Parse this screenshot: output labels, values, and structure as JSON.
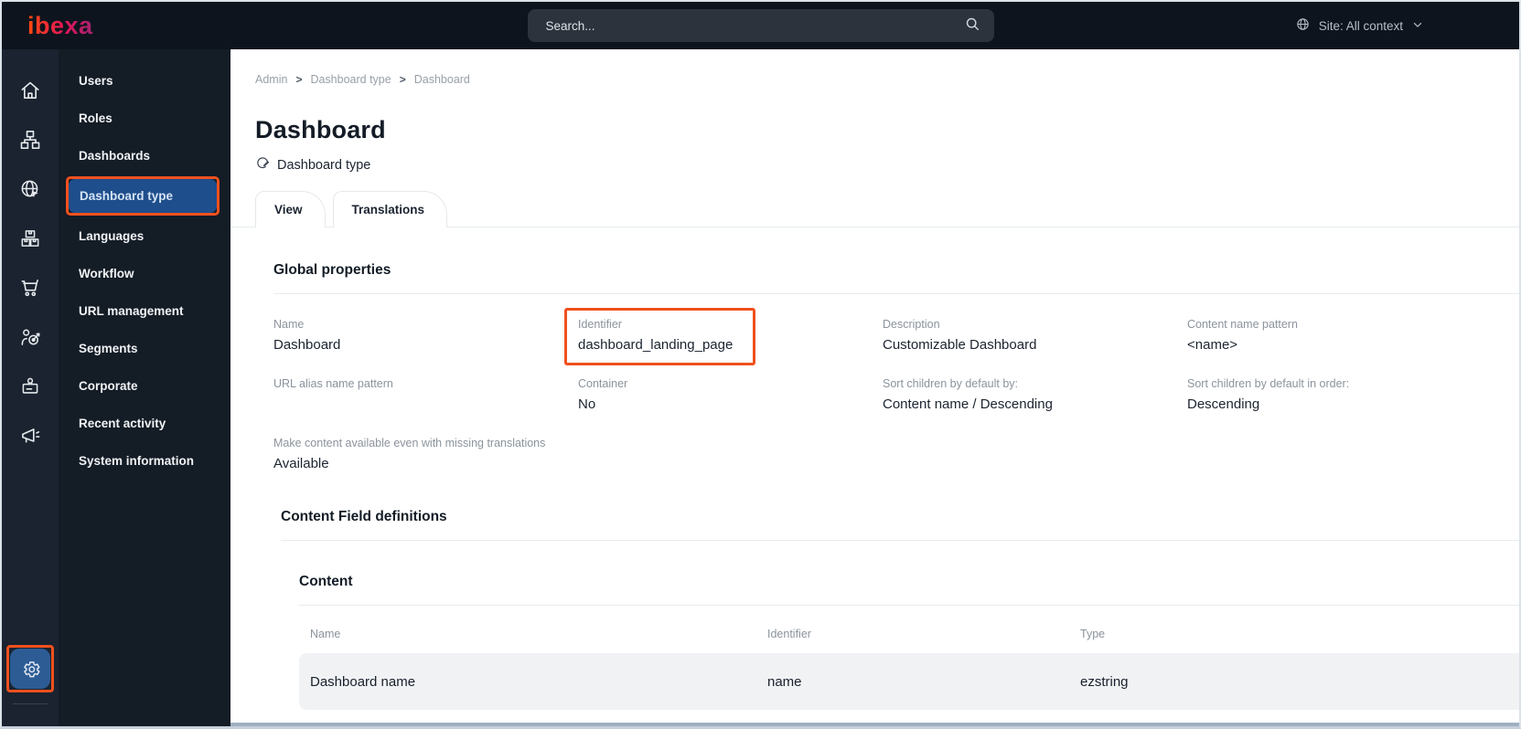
{
  "topbar": {
    "logo_text": "ibexa",
    "search": {
      "placeholder": "Search..."
    },
    "site_selector": {
      "label": "Site: All context"
    }
  },
  "rail": {
    "icons": [
      "home-icon",
      "content-tree-icon",
      "site-globe-icon",
      "product-catalog-icon",
      "commerce-cart-icon",
      "personalization-icon",
      "corporate-badge-icon",
      "marketing-megaphone-icon"
    ],
    "settings_icon": "gear-icon"
  },
  "sidebar": {
    "items": [
      {
        "label": "Users"
      },
      {
        "label": "Roles"
      },
      {
        "label": "Dashboards"
      },
      {
        "label": "Dashboard type",
        "selected": true
      },
      {
        "label": "Languages"
      },
      {
        "label": "Workflow"
      },
      {
        "label": "URL management"
      },
      {
        "label": "Segments"
      },
      {
        "label": "Corporate"
      },
      {
        "label": "Recent activity"
      },
      {
        "label": "System information"
      }
    ]
  },
  "breadcrumb": {
    "items": [
      "Admin",
      "Dashboard type",
      "Dashboard"
    ],
    "separator": ">"
  },
  "page": {
    "title": "Dashboard",
    "content_type": "Dashboard type"
  },
  "tabs": {
    "items": [
      {
        "label": "View",
        "active": true
      },
      {
        "label": "Translations",
        "active": false
      }
    ]
  },
  "global_properties": {
    "heading": "Global properties",
    "fields": [
      {
        "label": "Name",
        "value": "Dashboard"
      },
      {
        "label": "Identifier",
        "value": "dashboard_landing_page",
        "annotated": true
      },
      {
        "label": "Description",
        "value": "Customizable Dashboard"
      },
      {
        "label": "Content name pattern",
        "value": "<name>"
      },
      {
        "label": "URL alias name pattern",
        "value": ""
      },
      {
        "label": "Container",
        "value": "No"
      },
      {
        "label": "Sort children by default by:",
        "value": "Content name / Descending"
      },
      {
        "label": "Sort children by default in order:",
        "value": "Descending"
      },
      {
        "label": "Make content available even with missing translations",
        "value": "Available"
      }
    ]
  },
  "field_definitions": {
    "heading": "Content Field definitions",
    "group": {
      "heading": "Content",
      "table": {
        "headers": [
          "Name",
          "Identifier",
          "Type"
        ],
        "rows": [
          {
            "name": "Dashboard name",
            "identifier": "name",
            "type": "ezstring"
          }
        ]
      }
    }
  },
  "colors": {
    "annotation_orange": "#f0501e",
    "selected_item_blue": "#1f4e8c",
    "settings_tile_blue": "#2d5c95",
    "topbar_bg": "#0d141d",
    "rail_bg": "#1a232f",
    "menu_bg": "#141c26",
    "brand_gradient": [
      "#ff4713",
      "#e21657",
      "#a8216e"
    ]
  }
}
